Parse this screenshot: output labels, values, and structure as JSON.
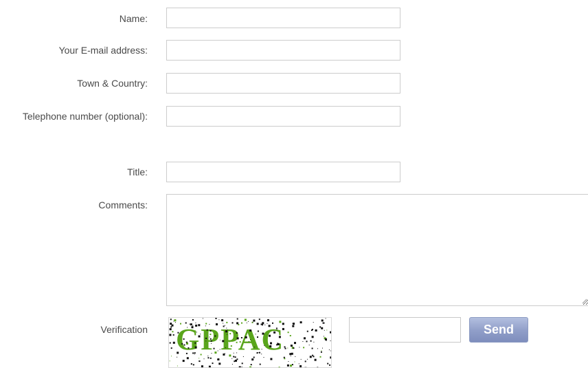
{
  "form": {
    "fields": [
      {
        "label": "Name:",
        "value": ""
      },
      {
        "label": "Your E-mail address:",
        "value": ""
      },
      {
        "label": "Town & Country:",
        "value": ""
      },
      {
        "label": "Telephone number (optional):",
        "value": ""
      },
      {
        "label": "Title:",
        "value": ""
      }
    ],
    "comments": {
      "label": "Comments:",
      "value": ""
    },
    "verification": {
      "label": "Verification",
      "captcha_text": "GPPAC",
      "input_value": ""
    },
    "send_label": "Send"
  },
  "colors": {
    "captcha_text": "#5aa51c",
    "button": "#8f9dc8",
    "border": "#cccccc"
  }
}
